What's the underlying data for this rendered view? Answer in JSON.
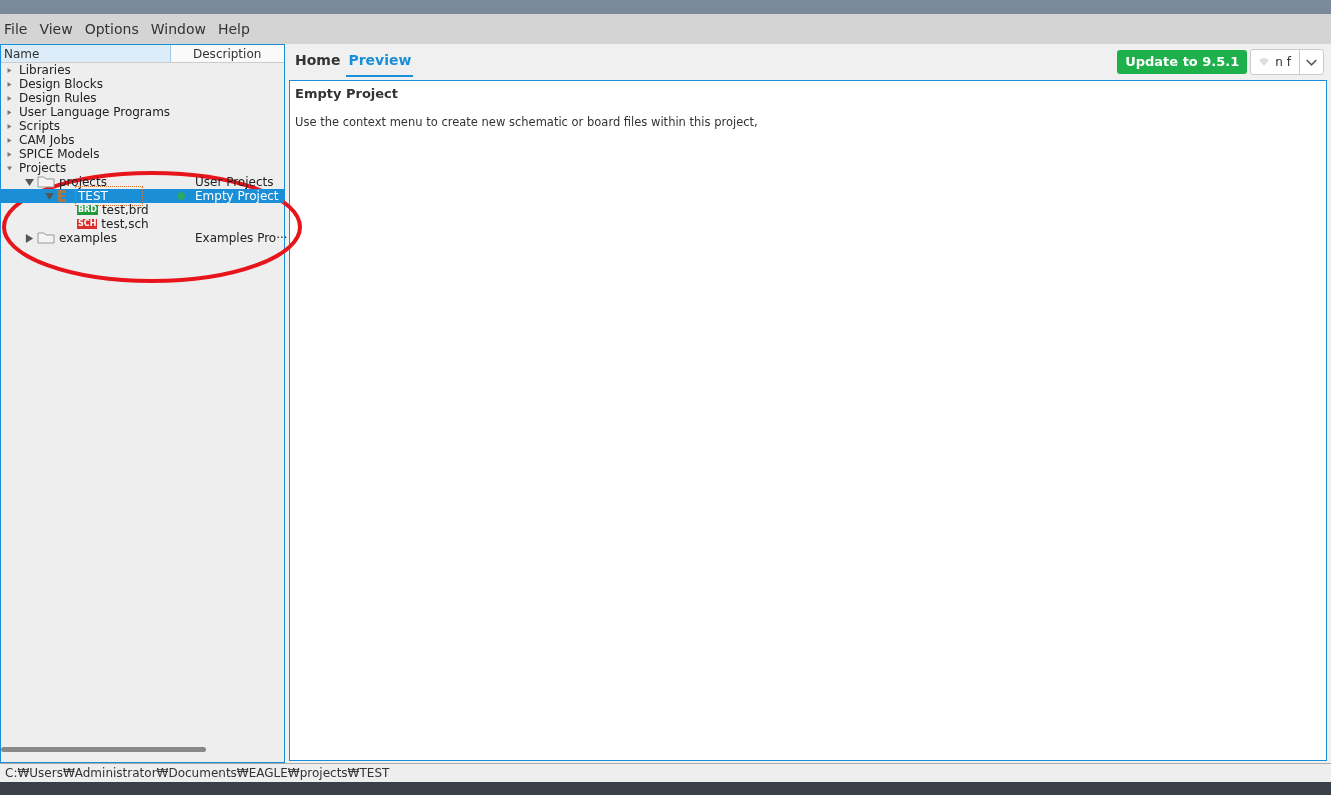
{
  "menu": [
    "File",
    "View",
    "Options",
    "Window",
    "Help"
  ],
  "tree": {
    "columns": [
      "Name",
      "Description"
    ],
    "items": [
      {
        "label": "Libraries",
        "kind": "category",
        "expanded": false
      },
      {
        "label": "Design Blocks",
        "kind": "category",
        "expanded": false
      },
      {
        "label": "Design Rules",
        "kind": "category",
        "expanded": false
      },
      {
        "label": "User Language Programs",
        "kind": "category",
        "expanded": false
      },
      {
        "label": "Scripts",
        "kind": "category",
        "expanded": false
      },
      {
        "label": "CAM Jobs",
        "kind": "category",
        "expanded": false
      },
      {
        "label": "SPICE Models",
        "kind": "category",
        "expanded": false
      },
      {
        "label": "Projects",
        "kind": "category",
        "expanded": true,
        "children": [
          {
            "label": "projects",
            "kind": "folder",
            "description": "User Projects",
            "expanded": true,
            "selected": false,
            "children": [
              {
                "label": "TEST",
                "kind": "project",
                "description": "Empty Project",
                "expanded": true,
                "selected": true,
                "color": "#2aa86a",
                "children": [
                  {
                    "label": "test,brd",
                    "kind": "file",
                    "badge": "BRD",
                    "color": "#1f9a3a",
                    "selected": false
                  },
                  {
                    "label": "test,sch",
                    "kind": "file",
                    "badge": "SCH",
                    "color": "#d9302c",
                    "selected": false
                  }
                ]
              }
            ]
          },
          {
            "label": "examples",
            "kind": "folder",
            "description": "Examples Pro···",
            "expanded": false,
            "selected": false
          }
        ]
      }
    ]
  },
  "tabs": [
    {
      "label": "Home",
      "selected": false
    },
    {
      "label": "Preview",
      "selected": true
    }
  ],
  "update_button": "Update to 9.5.1",
  "user_button": "n f",
  "preview": {
    "title": "Empty Project",
    "text": "Use the context menu to create new schematic or board files within this project,"
  },
  "status_bar": "C:₩Users₩Administrator₩Documents₩EAGLE₩projects₩TEST"
}
